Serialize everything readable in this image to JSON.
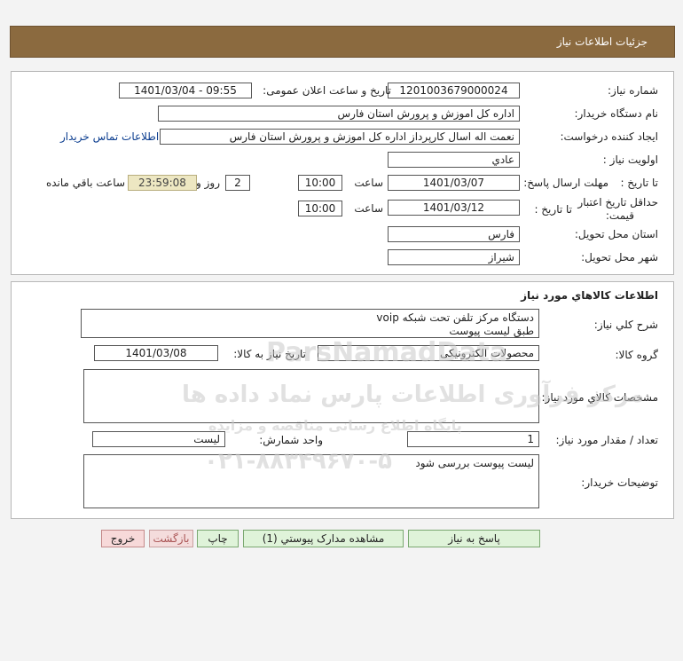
{
  "header": {
    "title": "جزئیات اطلاعات نیاز"
  },
  "details": {
    "need_number_label": "شماره نیاز:",
    "need_number": "1201003679000024",
    "announce_label": "تاریخ و ساعت اعلان عمومی:",
    "announce_value": "1401/03/04 - 09:55",
    "buyer_org_label": "نام دستگاه خریدار:",
    "buyer_org": "اداره کل اموزش و پرورش استان فارس",
    "requester_label": "ایجاد کننده درخواست:",
    "requester": "نعمت اله اسال کارپرداز اداره کل اموزش و پرورش استان فارس",
    "contact_link": "اطلاعات تماس خریدار",
    "priority_label": "اولویت نیاز :",
    "priority": "عادي",
    "deadline_label": "مهلت ارسال پاسخ:",
    "to_date_label": "تا تاریخ :",
    "deadline_date": "1401/03/07",
    "time_label": "ساعت",
    "deadline_time": "10:00",
    "days_value": "2",
    "days_label": "روز و",
    "remaining_time": "23:59:08",
    "remaining_label": "ساعت باقي مانده",
    "validity_label": "حداقل تاریخ اعتبار قیمت:",
    "validity_to_label": "تا تاریخ :",
    "validity_date": "1401/03/12",
    "validity_time_label": "ساعت",
    "validity_time": "10:00",
    "province_label": "استان محل تحویل:",
    "province": "فارس",
    "city_label": "شهر محل تحویل:",
    "city": "شیراز"
  },
  "goods": {
    "title": "اطلاعات کالاهاي مورد نیاز",
    "summary_label": "شرح کلي نیاز:",
    "summary_line1": "دستگاه مرکز تلفن تحت شبکه voip",
    "summary_line2": "طبق لیست پیوست",
    "group_label": "گروه کالا:",
    "group_value": "محصولات الکترونیکی",
    "need_date_label": "تاریخ نیاز به کالا:",
    "need_date": "1401/03/08",
    "specs_label": "مشخصات کالاي مورد نیاز:",
    "specs_value": "",
    "qty_label": "تعداد / مقدار مورد نیاز:",
    "qty_value": "1",
    "unit_label": "واحد شمارش:",
    "unit_value": "لیست",
    "buyer_notes_label": "توضیحات خریدار:",
    "buyer_notes": "لیست پیوست بررسی شود"
  },
  "buttons": {
    "reply": "پاسخ به نیاز",
    "attachments": "مشاهده مدارک پیوستي (1)",
    "print": "چاپ",
    "back": "بازگشت",
    "exit": "خروج"
  },
  "watermark": {
    "brand_en": "ParsNamadData",
    "line1": "مرکز فرآوری اطلاعات پارس نماد داده ها",
    "line2": "پایگاه اطلاع رسانی مناقصه و مزایده",
    "phone": "۰۲۱-۸۸۳۴۹۶۷۰-۵"
  },
  "colors": {
    "header_bg": "#8b6a3f",
    "timer_bg": "#ede7c2",
    "green_btn": "#dff3d9",
    "pink_btn": "#f7d9d9"
  }
}
